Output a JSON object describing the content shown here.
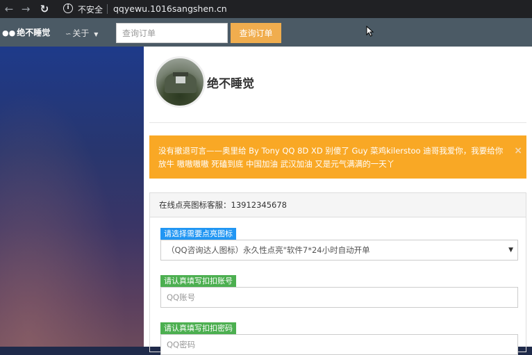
{
  "browser": {
    "security_label": "不安全",
    "url": "qqyewu.1016sangshen.cn"
  },
  "navbar": {
    "brand": "绝不睡觉",
    "about": "关于",
    "search_placeholder": "查询订单",
    "search_button": "查询订单"
  },
  "site": {
    "title": "绝不睡觉"
  },
  "notice": {
    "text": "没有撤退可言——奥里给 By Tony QQ 8D XD 别傻了 Guy 菜鸡kilerstoo 迪哥我爱你，我要给你放牛 嗷嗷嗷嗷 死磕到底 中国加油 武汉加油 又是元气满满的一天丫",
    "close": "×"
  },
  "form": {
    "header": "在线点亮图标客服：13912345678",
    "icon_label": "请选择需要点亮图标",
    "icon_selected": "（QQ咨询达人图标）永久性点亮\"软件7*24小时自动开单",
    "account_label": "请认真填写扣扣账号",
    "account_placeholder": "QQ账号",
    "password_label": "请认真填写扣扣密码",
    "password_placeholder": "QQ密码"
  },
  "colors": {
    "navbar": "#4b5a65",
    "search_button": "#f0ad4e",
    "alert": "#f9a825",
    "label_blue": "#2196f3",
    "label_green": "#4caf50"
  }
}
